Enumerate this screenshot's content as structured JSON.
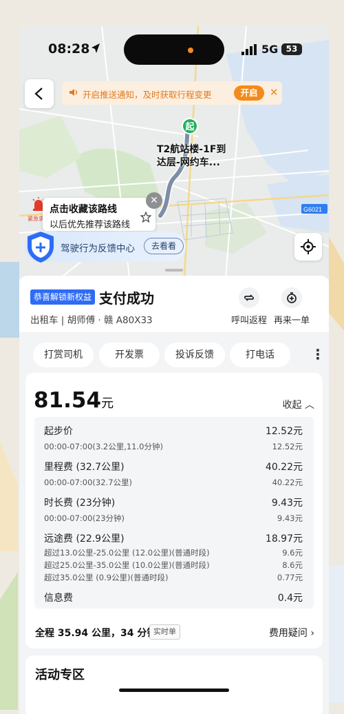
{
  "status_bar": {
    "time": "08:28",
    "network": "5G",
    "battery": "53"
  },
  "notification": {
    "text": "开启推送通知，及时获取行程变更",
    "button": "开启"
  },
  "map": {
    "start_marker": "起",
    "start_label": "T2航站楼-1F到达层-网约车...",
    "sos_label": "紧急求助",
    "favorite_line1": "点击收藏该路线",
    "favorite_line2": "以后优先推荐该路线",
    "feedback_text": "驾驶行为反馈中心",
    "feedback_button": "去看看"
  },
  "summary": {
    "badge": "恭喜解锁新权益",
    "title": "支付成功",
    "driver_info": "出租车 | 胡师傅 · 赣 A80X33",
    "actions": [
      {
        "label": "呼叫返程",
        "icon": "return-trip-icon"
      },
      {
        "label": "再来一单",
        "icon": "reorder-icon"
      }
    ]
  },
  "chips": [
    "打赏司机",
    "开发票",
    "投诉反馈",
    "打电话"
  ],
  "fare": {
    "total": "81.54",
    "unit": "元",
    "collapse_label": "收起",
    "items": [
      {
        "name": "起步价",
        "value": "12.52元",
        "details": [
          {
            "text": "00:00-07:00(3.2公里,11.0分钟)",
            "value": "12.52元"
          }
        ]
      },
      {
        "name": "里程费 (32.7公里)",
        "value": "40.22元",
        "details": [
          {
            "text": "00:00-07:00(32.7公里)",
            "value": "40.22元"
          }
        ]
      },
      {
        "name": "时长费 (23分钟)",
        "value": "9.43元",
        "details": [
          {
            "text": "00:00-07:00(23分钟)",
            "value": "9.43元"
          }
        ]
      },
      {
        "name": "远途费 (22.9公里)",
        "value": "18.97元",
        "details": [
          {
            "text": "超过13.0公里-25.0公里 (12.0公里)(普通时段)",
            "value": "9.6元"
          },
          {
            "text": "超过25.0公里-35.0公里 (10.0公里)(普通时段)",
            "value": "8.6元"
          },
          {
            "text": "超过35.0公里 (0.9公里)(普通时段)",
            "value": "0.77元"
          }
        ]
      },
      {
        "name": "信息费",
        "value": "0.4元",
        "details": []
      }
    ],
    "trip_summary": "全程 35.94 公里，34 分钟",
    "bill_type": "实时单",
    "fee_question": "费用疑问"
  },
  "activity": {
    "title": "活动专区"
  },
  "colors": {
    "accent_orange": "#f38a1b",
    "brand_blue": "#2e6cf6",
    "start_green": "#20b15a",
    "sos_red": "#e23c2c"
  }
}
